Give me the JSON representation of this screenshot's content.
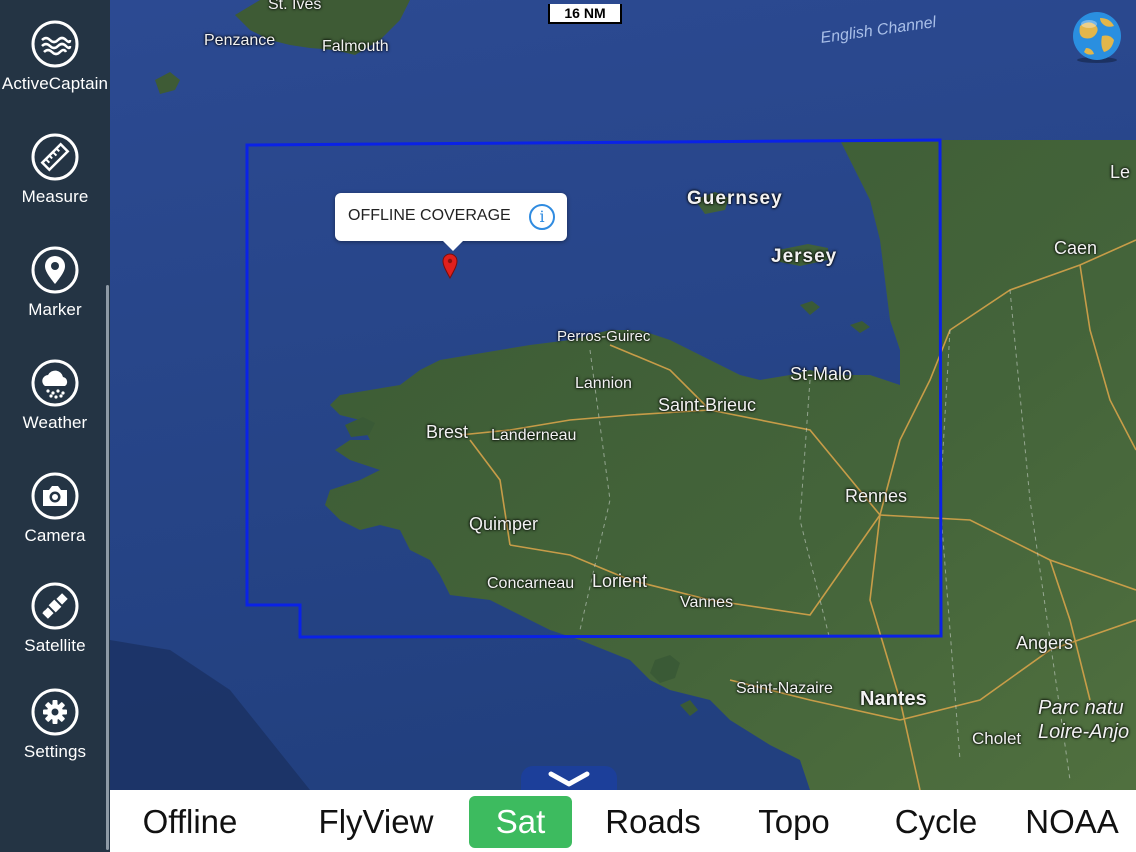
{
  "sidebar": {
    "items": [
      {
        "label": "ActiveCaptain",
        "icon": "activecaptain-wave-icon"
      },
      {
        "label": "Measure",
        "icon": "ruler-icon"
      },
      {
        "label": "Marker",
        "icon": "map-pin-icon"
      },
      {
        "label": "Weather",
        "icon": "cloud-rain-icon"
      },
      {
        "label": "Camera",
        "icon": "camera-icon"
      },
      {
        "label": "Satellite",
        "icon": "satellite-icon"
      },
      {
        "label": "Settings",
        "icon": "gear-icon"
      }
    ]
  },
  "map": {
    "scale": "16 NM",
    "callout": {
      "title": "OFFLINE COVERAGE",
      "info_icon": "info-icon"
    },
    "coverage_color": "#0a22e6",
    "labels": {
      "st_ives": "St. Ives",
      "penzance": "Penzance",
      "falmouth": "Falmouth",
      "english_channel": "English Channel",
      "guernsey": "Guernsey",
      "jersey": "Jersey",
      "le": "Le",
      "caen": "Caen",
      "perros": "Perros-Guirec",
      "lannion": "Lannion",
      "st_malo": "St-Malo",
      "saint_brieuc": "Saint-Brieuc",
      "brest": "Brest",
      "landerneau": "Landerneau",
      "rennes": "Rennes",
      "quimper": "Quimper",
      "concarneau": "Concarneau",
      "lorient": "Lorient",
      "vannes": "Vannes",
      "angers": "Angers",
      "saint_nazaire": "Saint-Nazaire",
      "nantes": "Nantes",
      "cholet": "Cholet",
      "parc": "Parc natu",
      "loire": "Loire-Anjo"
    }
  },
  "bottom_bar": {
    "layers": [
      {
        "label": "Offline",
        "active": false
      },
      {
        "label": "FlyView",
        "active": false
      },
      {
        "label": "Sat",
        "active": true
      },
      {
        "label": "Roads",
        "active": false
      },
      {
        "label": "Topo",
        "active": false
      },
      {
        "label": "Cycle",
        "active": false
      },
      {
        "label": "NOAA",
        "active": false
      }
    ],
    "active_color": "#3dbb5f"
  }
}
